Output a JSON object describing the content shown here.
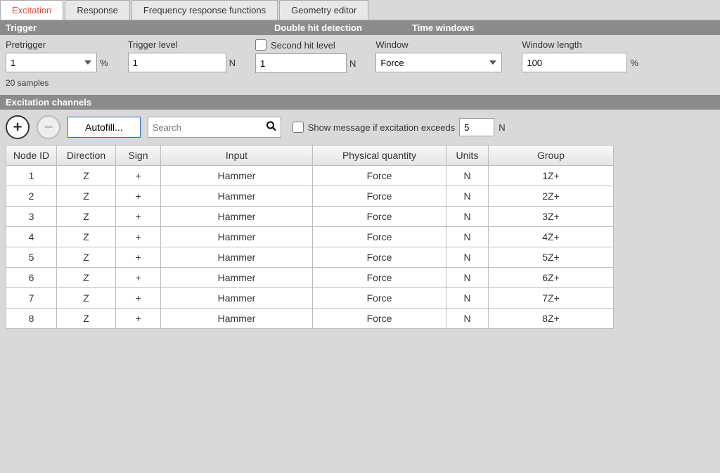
{
  "tabs": [
    "Excitation",
    "Response",
    "Frequency response functions",
    "Geometry editor"
  ],
  "activeTab": 0,
  "sectionHeaders": {
    "trigger": "Trigger",
    "doubleHit": "Double hit detection",
    "timeWindows": "Time windows"
  },
  "trigger": {
    "pretriggerLabel": "Pretrigger",
    "pretriggerValue": "1",
    "pretriggerUnit": "%",
    "pretriggerNote": "20 samples",
    "triggerLevelLabel": "Trigger level",
    "triggerLevelValue": "1",
    "triggerLevelUnit": "N"
  },
  "doubleHit": {
    "secondHitLabel": "Second hit level",
    "secondHitChecked": false,
    "secondHitValue": "1",
    "secondHitUnit": "N"
  },
  "timeWindows": {
    "windowLabel": "Window",
    "windowValue": "Force",
    "windowLengthLabel": "Window length",
    "windowLengthValue": "100",
    "windowLengthUnit": "%"
  },
  "channelsHeader": "Excitation channels",
  "toolbar": {
    "addIcon": "plus-icon",
    "removeIcon": "minus-icon",
    "autofillLabel": "Autofill...",
    "searchPlaceholder": "Search",
    "showMsgLabel": "Show message if excitation exceeds",
    "showMsgChecked": false,
    "exceedValue": "5",
    "exceedUnit": "N"
  },
  "table": {
    "headers": [
      "Node ID",
      "Direction",
      "Sign",
      "Input",
      "Physical quantity",
      "Units",
      "Group"
    ],
    "rows": [
      {
        "node": "1",
        "dir": "Z",
        "sign": "+",
        "input": "Hammer",
        "pq": "Force",
        "units": "N",
        "group": "1Z+"
      },
      {
        "node": "2",
        "dir": "Z",
        "sign": "+",
        "input": "Hammer",
        "pq": "Force",
        "units": "N",
        "group": "2Z+"
      },
      {
        "node": "3",
        "dir": "Z",
        "sign": "+",
        "input": "Hammer",
        "pq": "Force",
        "units": "N",
        "group": "3Z+"
      },
      {
        "node": "4",
        "dir": "Z",
        "sign": "+",
        "input": "Hammer",
        "pq": "Force",
        "units": "N",
        "group": "4Z+"
      },
      {
        "node": "5",
        "dir": "Z",
        "sign": "+",
        "input": "Hammer",
        "pq": "Force",
        "units": "N",
        "group": "5Z+"
      },
      {
        "node": "6",
        "dir": "Z",
        "sign": "+",
        "input": "Hammer",
        "pq": "Force",
        "units": "N",
        "group": "6Z+"
      },
      {
        "node": "7",
        "dir": "Z",
        "sign": "+",
        "input": "Hammer",
        "pq": "Force",
        "units": "N",
        "group": "7Z+"
      },
      {
        "node": "8",
        "dir": "Z",
        "sign": "+",
        "input": "Hammer",
        "pq": "Force",
        "units": "N",
        "group": "8Z+"
      }
    ]
  }
}
